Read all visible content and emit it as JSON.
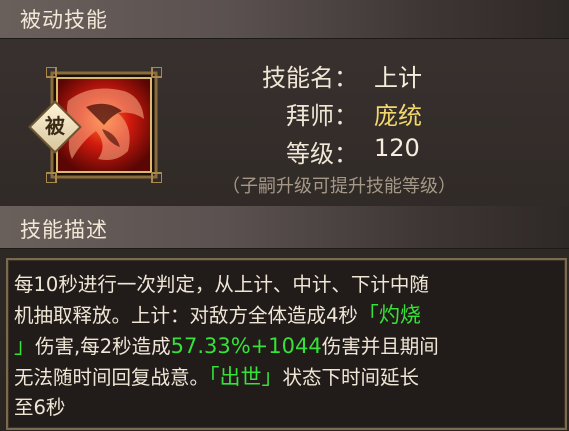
{
  "sections": {
    "passive_title": "被动技能",
    "desc_title": "技能描述"
  },
  "skill": {
    "badge": "被",
    "name_label": "技能名：",
    "name_value": "上计",
    "master_label": "拜师：",
    "master_value": "庞统",
    "level_label": "等级：",
    "level_value": "120",
    "hint": "（子嗣升级可提升技能等级）"
  },
  "description": {
    "line1": "每10秒进行一次判定，从上计、中计、下计中随",
    "line2a": "机抽取释放。上计：对敌方全体造成4秒",
    "line2b": "「灼烧",
    "line3a": "」",
    "line3b": "伤害,每2秒造成",
    "line3c": "57.33%+1044",
    "line3d": "伤害并且期间",
    "line4a": "无法随时间回复战意。",
    "line4b": "「出世」",
    "line4c": "状态下时间延长",
    "line5": "至6秒"
  },
  "colors": {
    "accent_green": "#35e238",
    "accent_gold": "#f2d76d",
    "icon_red": "#c8140c"
  },
  "icons": {
    "skill_icon": "red-warrior-portrait-icon"
  }
}
